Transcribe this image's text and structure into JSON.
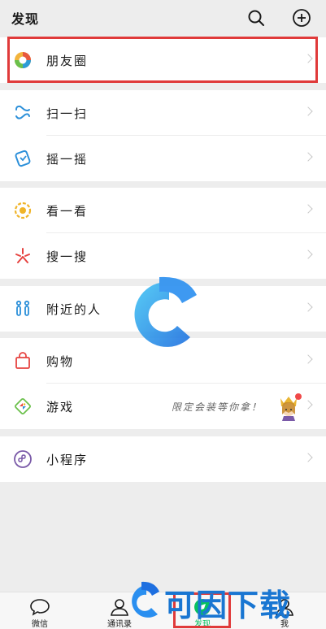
{
  "header": {
    "title": "发现"
  },
  "rows": {
    "moments": {
      "label": "朋友圈"
    },
    "scan": {
      "label": "扫一扫"
    },
    "shake": {
      "label": "摇一摇"
    },
    "top_stories": {
      "label": "看一看"
    },
    "search": {
      "label": "搜一搜"
    },
    "nearby": {
      "label": "附近的人"
    },
    "shopping": {
      "label": "购物"
    },
    "games": {
      "label": "游戏",
      "promo": "限定会装等你拿！"
    },
    "mini_programs": {
      "label": "小程序"
    }
  },
  "tabbar": [
    {
      "label": "微信"
    },
    {
      "label": "通讯录"
    },
    {
      "label": "发现"
    },
    {
      "label": "我"
    }
  ],
  "watermark": {
    "text": "可因下载"
  },
  "colors": {
    "accent_green": "#07c160",
    "highlight_red": "#e03a3a",
    "watermark_blue": "#1976d2"
  }
}
